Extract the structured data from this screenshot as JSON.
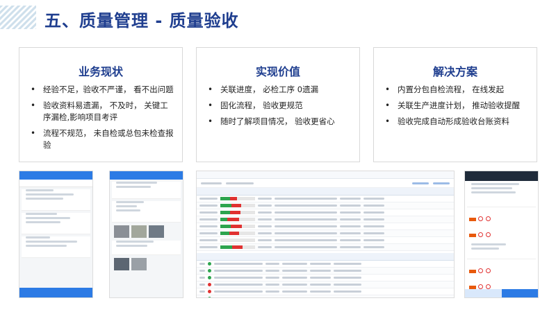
{
  "page": {
    "title": "五、质量管理 - 质量验收"
  },
  "cards": [
    {
      "heading": "业务现状",
      "items": [
        "经验不足，验收不严谨， 看不出问题",
        "验收资料易遗漏， 不及时， 关键工序漏检,影响项目考评",
        "流程不规范， 未自检或总包未检查报验"
      ]
    },
    {
      "heading": "实现价值",
      "items": [
        "关联进度， 必检工序 0遗漏",
        "固化流程， 验收更规范",
        "随时了解项目情况， 验收更省心"
      ]
    },
    {
      "heading": "解决方案",
      "items": [
        "内置分包自检流程， 在线发起",
        "关联生产进度计划， 推动验收提醒",
        "验收完成自动形成验收台账资料"
      ]
    }
  ],
  "screenshots": {
    "workbench_progress": [
      {
        "green": 0.27,
        "red": 0.2
      },
      {
        "green": 0.32,
        "red": 0.28
      },
      {
        "green": 0.28,
        "red": 0.3
      },
      {
        "green": 0.2,
        "red": 0.34
      },
      {
        "green": 0.3,
        "red": 0.32
      },
      {
        "green": 0.25,
        "red": 0.28
      },
      {
        "green": 0.0,
        "red": 0.0
      },
      {
        "green": 0.33,
        "red": 0.3
      }
    ],
    "workbench_status": [
      "g",
      "g",
      "g",
      "r",
      "r",
      "g",
      "r",
      "g"
    ],
    "colors": {
      "primary_blue": "#2c7be5",
      "title_blue": "#1f3e8f",
      "ok_green": "#2da44e",
      "fail_red": "#e03131",
      "dark_header": "#1f2b3a"
    }
  }
}
